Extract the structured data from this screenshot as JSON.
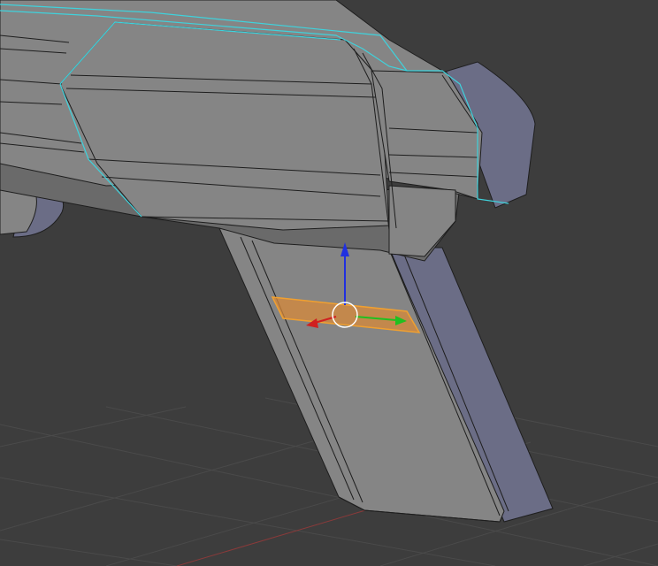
{
  "viewport": {
    "view_type": "3d-viewport",
    "background_color": "#3d3d3d",
    "grid_color": "#4a4a4a",
    "axis_x_color": "#8a3a3a"
  },
  "mesh": {
    "body_face_color": "#858585",
    "body_shade_color": "#6a6a6a",
    "side_face_color": "#6b6d86",
    "edge_color": "#1e1e1e",
    "selected_outline_color": "#3fd2dc",
    "selected_face_color": "#d8893a",
    "selected_edge_color": "#f0a030"
  },
  "gizmo": {
    "x_axis_color": "#d02020",
    "y_axis_color": "#20c020",
    "z_axis_color": "#2030e0",
    "pivot_ring_color": "#ffffff"
  }
}
